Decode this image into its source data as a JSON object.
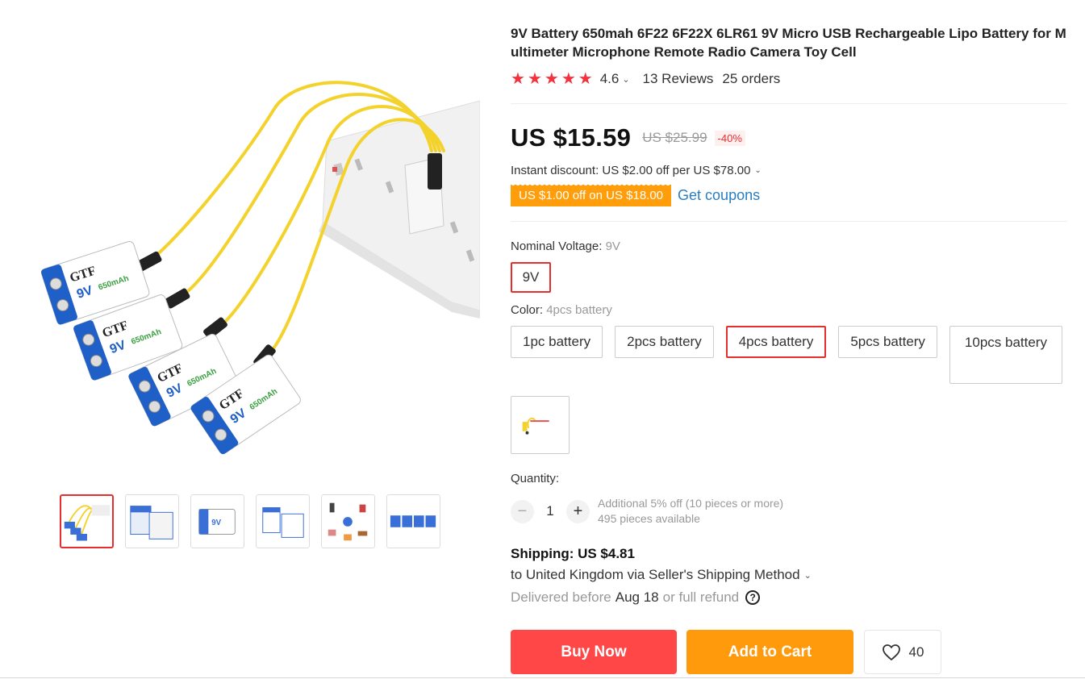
{
  "product": {
    "title": "9V Battery 650mah 6F22 6F22X 6LR61 9V Micro USB Rechargeable Lipo Battery for Multimeter Microphone Remote Radio Camera Toy Cell",
    "rating": "4.6",
    "reviews": "13 Reviews",
    "orders": "25 orders",
    "stars": 5
  },
  "price": {
    "current": "US $15.59",
    "original": "US $25.99",
    "discount": "-40%",
    "instant_discount": "Instant discount: US $2.00 off per US $78.00",
    "coupon_tag": "US $1.00 off on US $18.00",
    "get_coupons": "Get coupons"
  },
  "nominal_voltage": {
    "label": "Nominal Voltage: ",
    "value": "9V",
    "options": [
      "9V"
    ]
  },
  "color": {
    "label": "Color: ",
    "value": "4pcs battery",
    "options": [
      "1pc battery",
      "2pcs battery",
      "4pcs battery",
      "5pcs battery",
      "10pcs battery"
    ]
  },
  "quantity": {
    "label": "Quantity:",
    "minus": "−",
    "plus": "+",
    "value": "1",
    "bulk_discount": "Additional 5% off (10 pieces or more)",
    "available": "495 pieces available"
  },
  "shipping": {
    "title": "Shipping: US $4.81",
    "route": "to United Kingdom via Seller's Shipping Method",
    "delivered_prefix": "Delivered before",
    "delivered_date": "Aug 18",
    "delivered_suffix": "or full refund",
    "help": "?"
  },
  "actions": {
    "buy_now": "Buy Now",
    "add_to_cart": "Add to Cart",
    "wishlist_count": "40"
  },
  "icons": {
    "star": "star-icon",
    "chevron": "chevron-down-icon",
    "heart": "heart-icon",
    "help": "question-circle-icon"
  },
  "colors": {
    "accent_red": "#ff4747",
    "accent_orange": "#ff9a0c",
    "link_blue": "#2a7ec0",
    "selected_border": "#e62e2e",
    "star": "#f5313e"
  }
}
